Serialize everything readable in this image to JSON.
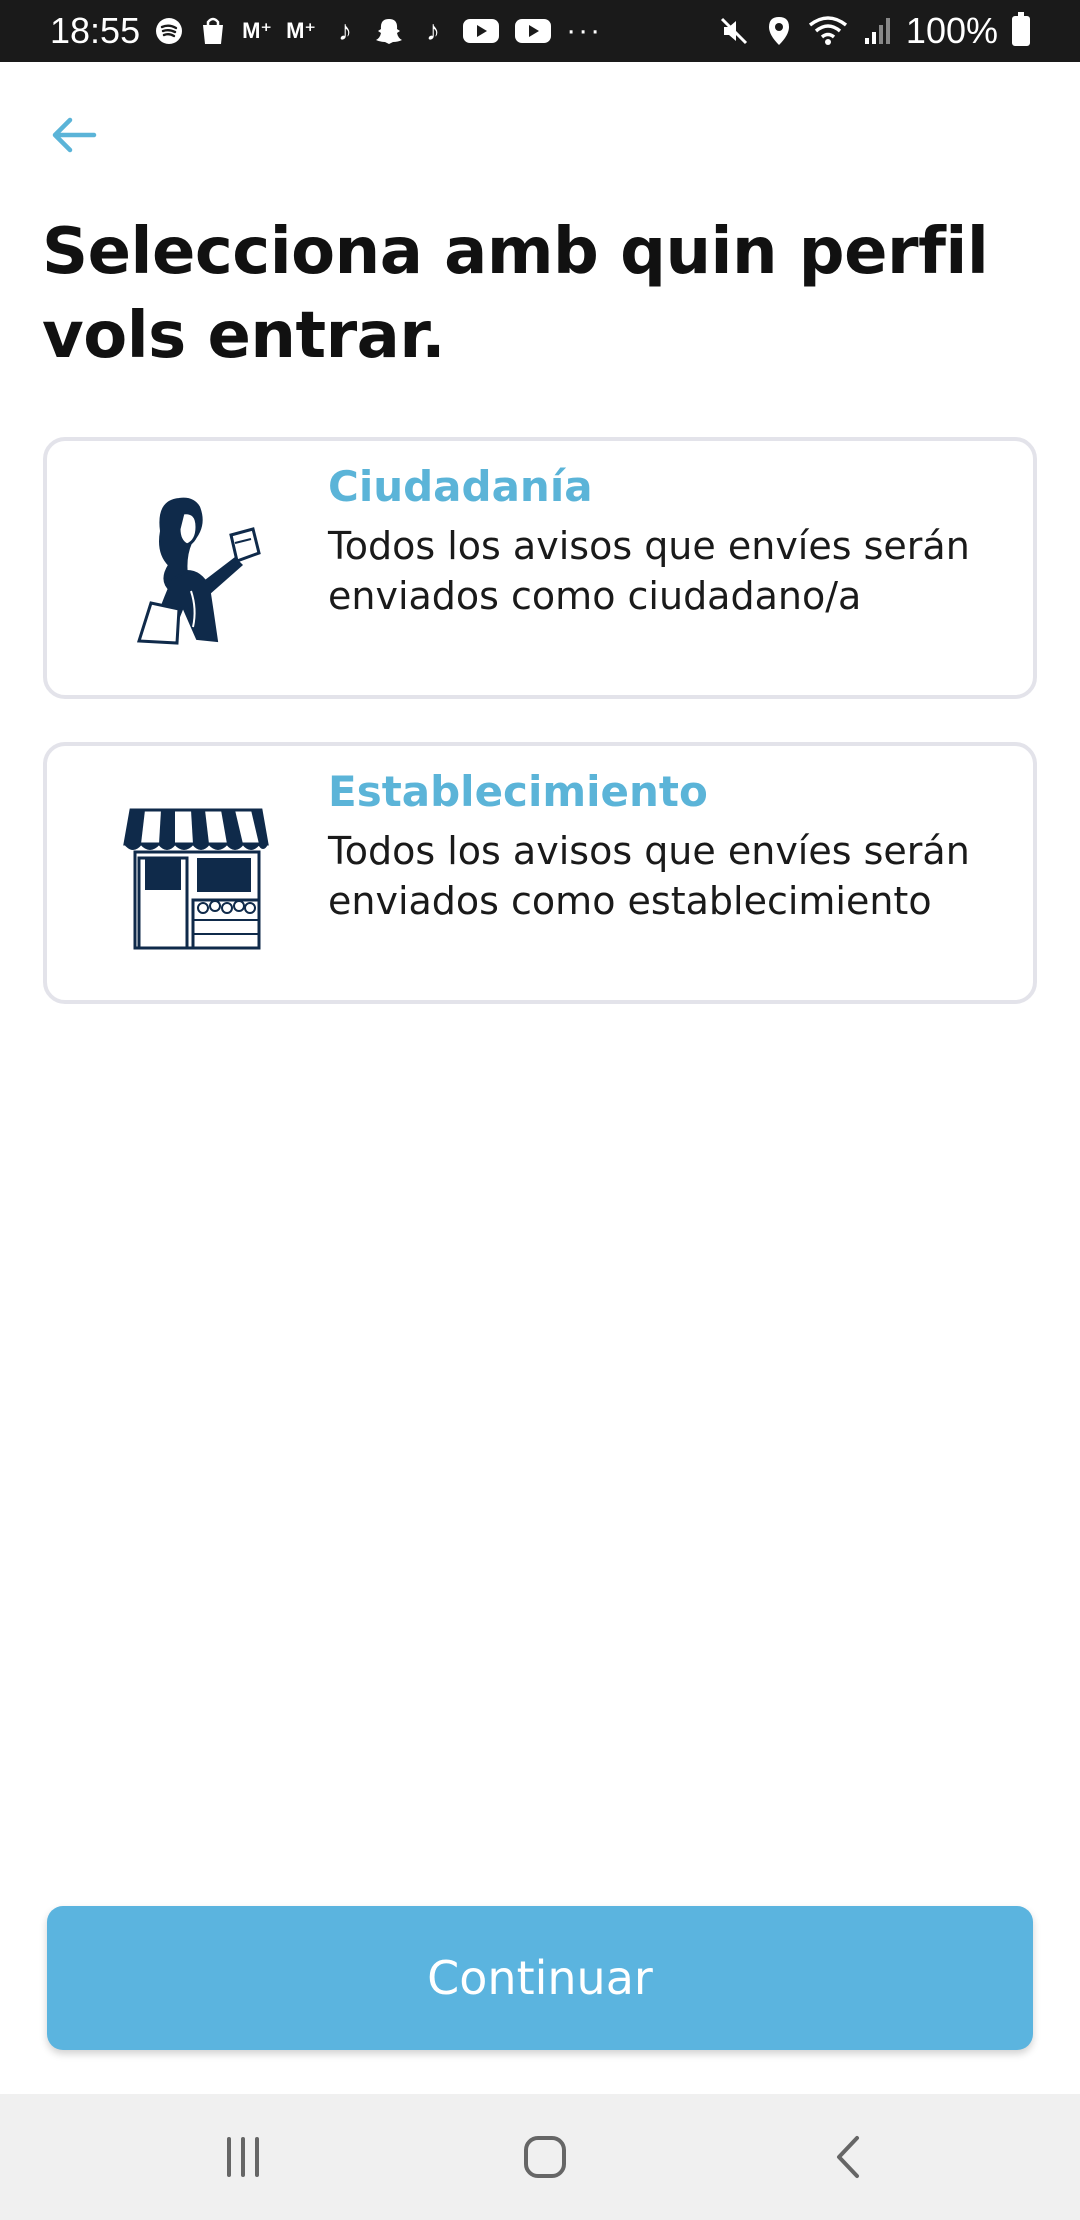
{
  "status_bar": {
    "time": "18:55",
    "battery": "100%",
    "notification_icons": [
      "spotify-icon",
      "shopping-bag-icon",
      "movistar-plus-icon",
      "movistar-plus-icon",
      "tiktok-icon",
      "snapchat-icon",
      "tiktok-icon",
      "youtube-icon",
      "youtube-icon"
    ],
    "system_icons": [
      "mute-icon",
      "location-icon",
      "wifi-icon",
      "signal-icon",
      "battery-icon"
    ],
    "overflow": "···"
  },
  "header": {
    "title": "Selecciona amb quin perfil vols entrar."
  },
  "profiles": [
    {
      "title": "Ciudadanía",
      "description": "Todos los avisos que envíes serán enviados como ciudadano/a",
      "icon": "citizen-illustration"
    },
    {
      "title": "Establecimiento",
      "description": "Todos los avisos que envíes serán enviados como establecimiento",
      "icon": "store-illustration"
    }
  ],
  "actions": {
    "continue_label": "Continuar"
  },
  "colors": {
    "accent": "#5bb4d8",
    "button": "#5bb4df",
    "illustration_dark": "#0f2a4a",
    "card_border": "#e3e3ea"
  }
}
